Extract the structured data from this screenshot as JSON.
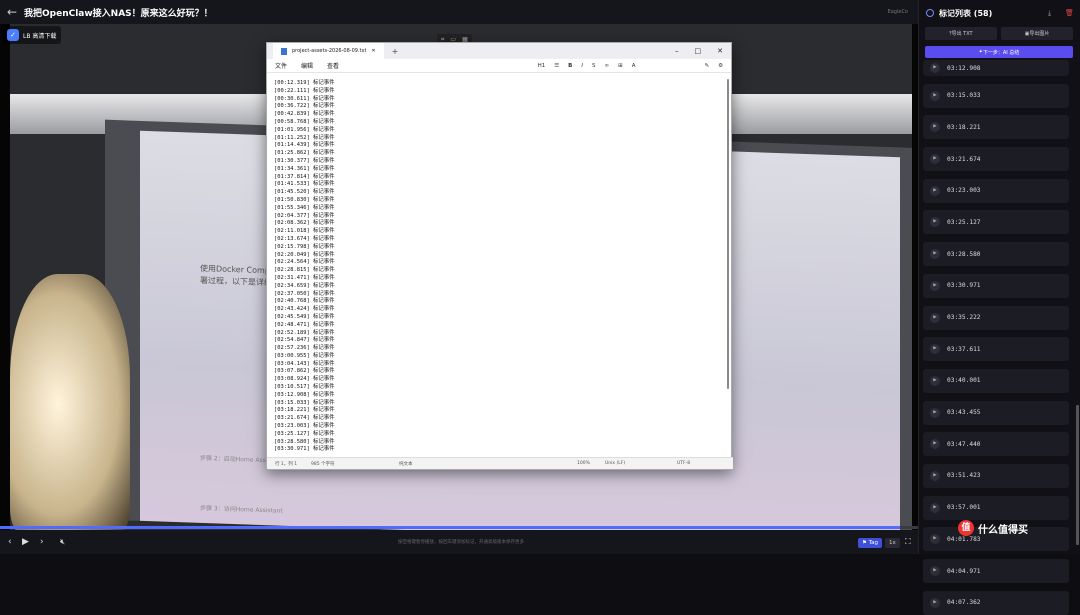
{
  "header": {
    "title": "我把OpenClaw接入NAS！原来这么好玩？！",
    "right_text": "EagleCo"
  },
  "video": {
    "brand_label": "LB 高清下载",
    "monitor_text": [
      "使用Docker Compose安装",
      "署过程，以下是详细的步骤",
      "步骤 2：启动Home Assistant",
      "步骤 3：访问Home Assistant"
    ]
  },
  "notepad": {
    "tab_title": "project-assets-2026-08-09.txt",
    "menu": [
      "文件",
      "编辑",
      "查看"
    ],
    "heading_tool": "H1",
    "lines": [
      "[00:12.319] 标记事件",
      "[00:22.111] 标记事件",
      "[00:30.611] 标记事件",
      "[00:36.722] 标记事件",
      "[00:42.839] 标记事件",
      "[00:58.768] 标记事件",
      "[01:01.956] 标记事件",
      "[01:11.252] 标记事件",
      "[01:14.439] 标记事件",
      "[01:25.862] 标记事件",
      "[01:30.377] 标记事件",
      "[01:34.361] 标记事件",
      "[01:37.814] 标记事件",
      "[01:41.533] 标记事件",
      "[01:45.520] 标记事件",
      "[01:50.830] 标记事件",
      "[01:55.346] 标记事件",
      "[02:04.377] 标记事件",
      "[02:08.362] 标记事件",
      "[02:11.018] 标记事件",
      "[02:13.674] 标记事件",
      "[02:15.798] 标记事件",
      "[02:20.049] 标记事件",
      "[02:24.564] 标记事件",
      "[02:28.815] 标记事件",
      "[02:31.471] 标记事件",
      "[02:34.659] 标记事件",
      "[02:37.050] 标记事件",
      "[02:40.768] 标记事件",
      "[02:43.424] 标记事件",
      "[02:45.549] 标记事件",
      "[02:48.471] 标记事件",
      "[02:52.189] 标记事件",
      "[02:54.847] 标记事件",
      "[02:57.236] 标记事件",
      "[03:00.955] 标记事件",
      "[03:04.143] 标记事件",
      "[03:07.862] 标记事件",
      "[03:08.924] 标记事件",
      "[03:10.517] 标记事件",
      "[03:12.908] 标记事件",
      "[03:15.033] 标记事件",
      "[03:18.221] 标记事件",
      "[03:21.674] 标记事件",
      "[03:23.003] 标记事件",
      "[03:25.127] 标记事件",
      "[03:28.580] 标记事件",
      "[03:30.971] 标记事件"
    ],
    "status": {
      "position": "行 1，列 1",
      "chars": "985 个字符",
      "format": "纯文本",
      "zoom": "100%",
      "eol": "Unix (LF)",
      "encoding": "UTF-8"
    }
  },
  "player": {
    "hint": "按空格键暂停播放，按回车键添加标记，开通高级版本保存更多",
    "tag_label": "Tag",
    "speed": "1x",
    "progress": 0.98
  },
  "panel": {
    "title": "标记列表 (58)",
    "export_label": "导出 TXT",
    "copy_label": "导出图片",
    "next_label": "下一步：AI 总结",
    "items": [
      "03:12.908",
      "03:15.033",
      "03:18.221",
      "03:21.674",
      "03:23.003",
      "03:25.127",
      "03:28.580",
      "03:30.971",
      "03:35.222",
      "03:37.611",
      "03:40.001",
      "03:43.455",
      "03:47.440",
      "03:51.423",
      "03:57.001",
      "04:01.783",
      "04:04.971",
      "04:07.362"
    ]
  },
  "watermark": {
    "text": "什么值得买",
    "logo": "值"
  },
  "colors": {
    "accent": "#5b4cf0",
    "tag": "#3e4fd8",
    "panel_bg": "#101016"
  }
}
